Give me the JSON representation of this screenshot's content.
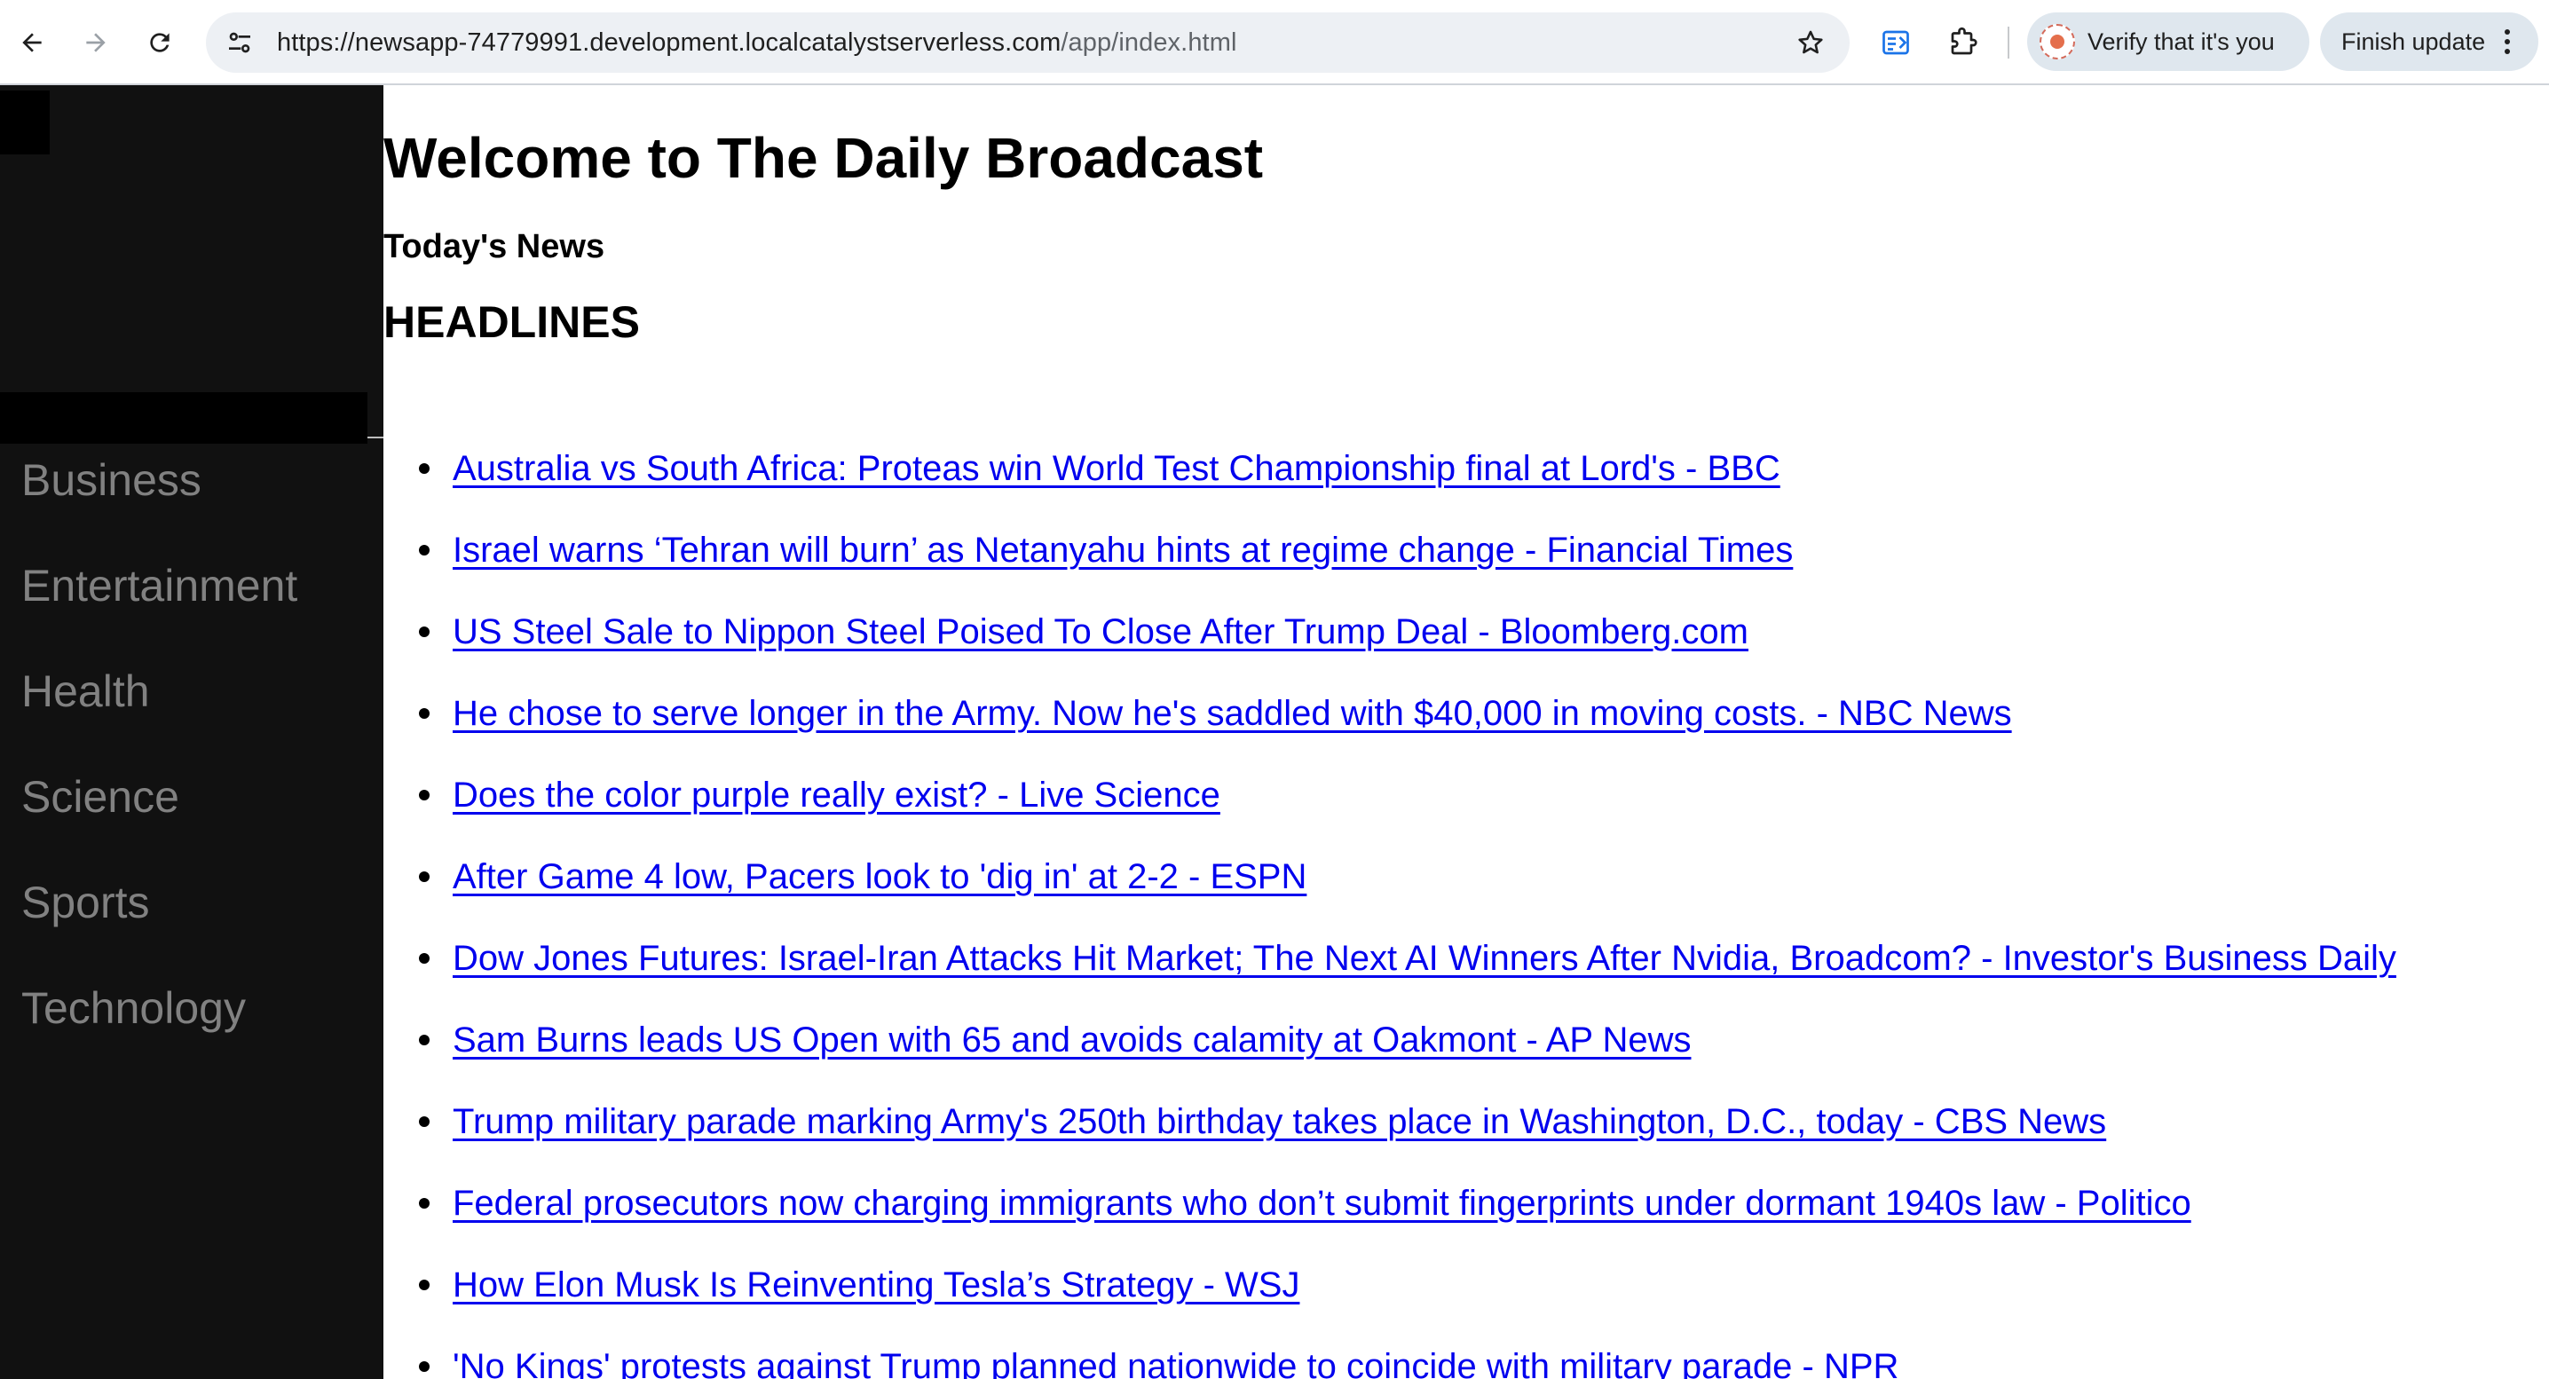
{
  "browser": {
    "url_host": "https://newsapp-74779991.development.localcatalystserverless.com",
    "url_path": "/app/index.html",
    "verify_label": "Verify that it's you",
    "update_label": "Finish update",
    "icons": [
      "back-icon",
      "forward-icon",
      "reload-icon",
      "site-info-icon",
      "star-icon",
      "reading-mode-icon",
      "extensions-icon",
      "profile-icon",
      "more-icon"
    ]
  },
  "sidebar": {
    "items": [
      {
        "label": "Business"
      },
      {
        "label": "Entertainment"
      },
      {
        "label": "Health"
      },
      {
        "label": "Science"
      },
      {
        "label": "Sports"
      },
      {
        "label": "Technology"
      }
    ]
  },
  "main": {
    "title": "Welcome to The Daily Broadcast",
    "subtitle": "Today's News",
    "section_title": "HEADLINES",
    "headlines": [
      {
        "text": "Australia vs South Africa: Proteas win World Test Championship final at Lord's - BBC"
      },
      {
        "text": "Israel warns ‘Tehran will burn’ as Netanyahu hints at regime change - Financial Times"
      },
      {
        "text": "US Steel Sale to Nippon Steel Poised To Close After Trump Deal - Bloomberg.com"
      },
      {
        "text": "He chose to serve longer in the Army. Now he's saddled with $40,000 in moving costs. - NBC News"
      },
      {
        "text": "Does the color purple really exist? - Live Science"
      },
      {
        "text": "After Game 4 low, Pacers look to 'dig in' at 2-2 - ESPN"
      },
      {
        "text": "Dow Jones Futures: Israel-Iran Attacks Hit Market; The Next AI Winners After Nvidia, Broadcom? - Investor's Business Daily"
      },
      {
        "text": "Sam Burns leads US Open with 65 and avoids calamity at Oakmont - AP News"
      },
      {
        "text": "Trump military parade marking Army's 250th birthday takes place in Washington, D.C., today - CBS News"
      },
      {
        "text": "Federal prosecutors now charging immigrants who don’t submit fingerprints under dormant 1940s law - Politico"
      },
      {
        "text": "How Elon Musk Is Reinventing Tesla’s Strategy - WSJ"
      },
      {
        "text": "'No Kings' protests against Trump planned nationwide to coincide with military parade - NPR"
      }
    ]
  },
  "colors": {
    "sidebar_bg": "#111111",
    "sidebar_text": "#818181",
    "link": "#0000ee",
    "omnibox_bg": "#edf0f4",
    "pill_bg": "#dfe7ee"
  }
}
